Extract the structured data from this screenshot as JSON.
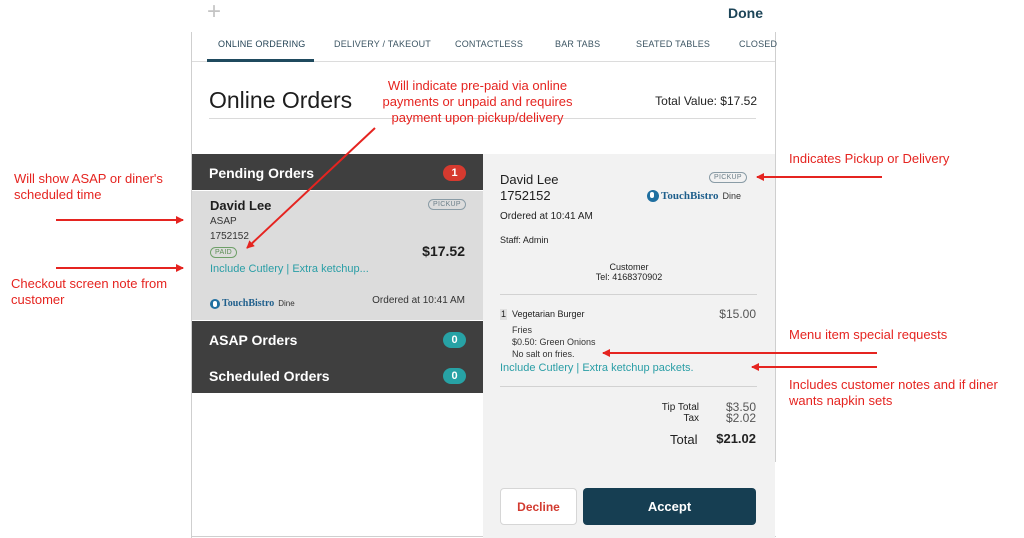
{
  "topbar": {
    "plus_icon": "plus-icon",
    "done_label": "Done"
  },
  "tabs": [
    {
      "label": "ONLINE ORDERING",
      "active": true
    },
    {
      "label": "DELIVERY / TAKEOUT",
      "active": false
    },
    {
      "label": "CONTACTLESS",
      "active": false
    },
    {
      "label": "BAR TABS",
      "active": false
    },
    {
      "label": "SEATED TABLES",
      "active": false
    },
    {
      "label": "CLOSED",
      "active": false
    }
  ],
  "header": {
    "title": "Online Orders",
    "total_value": "Total Value: $17.52"
  },
  "sections": {
    "pending": {
      "label": "Pending Orders",
      "count": "1"
    },
    "asap": {
      "label": "ASAP Orders",
      "count": "0"
    },
    "scheduled": {
      "label": "Scheduled Orders",
      "count": "0"
    }
  },
  "order_card": {
    "name": "David Lee",
    "timing": "ASAP",
    "order_number": "1752152",
    "type_badge": "PICKUP",
    "payment_badge": "PAID",
    "amount": "$17.52",
    "note": "Include Cutlery | Extra ketchup...",
    "brand": "TouchBistro",
    "brand_suffix": "Dine",
    "ordered_at": "Ordered at 10:41 AM"
  },
  "detail": {
    "name": "David Lee",
    "order_number": "1752152",
    "type_badge": "PICKUP",
    "brand": "TouchBistro",
    "brand_suffix": "Dine",
    "ordered_at": "Ordered at 10:41 AM",
    "staff": "Staff: Admin",
    "customer_heading": "Customer",
    "customer_tel": "Tel: 4168370902",
    "item": {
      "qty": "1",
      "name": "Vegetarian Burger",
      "price": "$15.00",
      "modifiers": [
        "Fries",
        "$0.50: Green Onions",
        "No salt on fries."
      ]
    },
    "note": "Include Cutlery | Extra ketchup packets.",
    "tip_label": "Tip Total",
    "tip_value": "$3.50",
    "tax_label": "Tax",
    "tax_value": "$2.02",
    "total_label": "Total",
    "total_value": "$21.02",
    "decline_label": "Decline",
    "accept_label": "Accept"
  },
  "annotations": {
    "prepaid": [
      "Will indicate pre-paid via online",
      "payments or unpaid and requires",
      "payment upon pickup/delivery"
    ],
    "asap_time": [
      "Will show ASAP or diner's",
      "scheduled time"
    ],
    "checkout_note": [
      "Checkout screen note from",
      "customer"
    ],
    "pickup_delivery": [
      "Indicates Pickup or Delivery"
    ],
    "menu_requests": [
      "Menu item special requests"
    ],
    "customer_notes": [
      "Includes customer notes and if diner",
      "wants napkin sets"
    ]
  },
  "colors": {
    "annotation_red": "#e52420",
    "accent_teal": "#2a9ea6",
    "accept_navy": "#163e52",
    "section_dark": "#3f3f3f",
    "badge_red": "#d63a2f",
    "badge_teal": "#27a2a5"
  }
}
